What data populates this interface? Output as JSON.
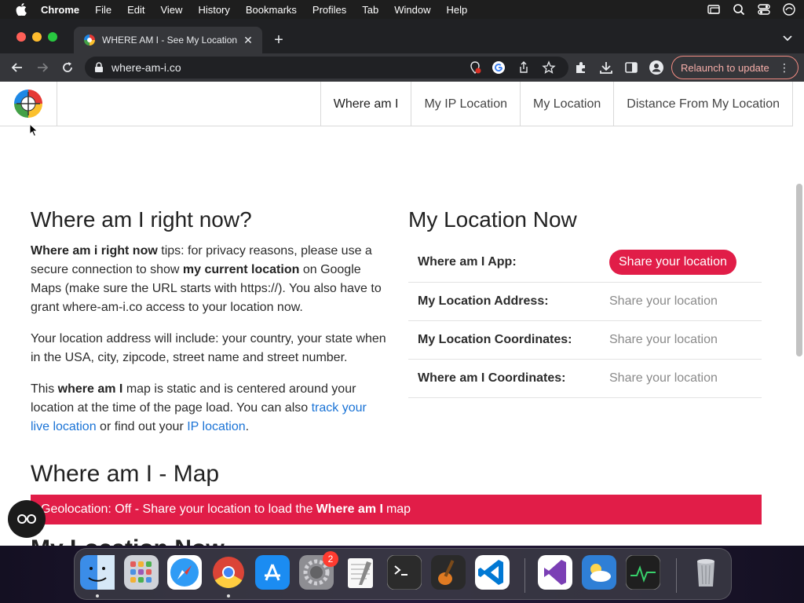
{
  "menubar": {
    "app_name": "Chrome",
    "items": [
      "File",
      "Edit",
      "View",
      "History",
      "Bookmarks",
      "Profiles",
      "Tab",
      "Window",
      "Help"
    ]
  },
  "browser": {
    "tab_title": "WHERE AM I - See My Location",
    "url": "where-am-i.co",
    "relaunch_label": "Relaunch to update"
  },
  "site": {
    "nav": [
      "Where am I",
      "My IP Location",
      "My Location",
      "Distance From My Location"
    ]
  },
  "intro": {
    "heading": "Where am I right now?",
    "p1_b1": "Where am i right now",
    "p1_t1": " tips: for privacy reasons, please use a secure connection to show ",
    "p1_b2": "my current location",
    "p1_t2": " on Google Maps (make sure the URL starts with https://). You also have to grant where-am-i.co access to your location now.",
    "p2": "Your location address will include: your country, your state when in the USA, city, zipcode, street name and street number.",
    "p3_t1": "This ",
    "p3_b1": "where am I",
    "p3_t2": " map is static and is centered around your location at the time of the page load. You can also ",
    "p3_link1": "track your live location",
    "p3_t3": " or find out your ",
    "p3_link2": "IP location",
    "p3_t4": "."
  },
  "location_now": {
    "heading": "My Location Now",
    "rows": [
      {
        "label": "Where am I App:",
        "value": "Share your location"
      },
      {
        "label": "My Location Address:",
        "value": "Share your location"
      },
      {
        "label": "My Location Coordinates:",
        "value": "Share your location"
      },
      {
        "label": "Where am I Coordinates:",
        "value": "Share your location"
      }
    ]
  },
  "map": {
    "heading": "Where am I - Map",
    "alert_pre": "Geolocation: Off - Share your location to load the",
    "alert_bold": "Where am I",
    "alert_post": "map",
    "next_heading": "My Location Now"
  },
  "dock": {
    "settings_badge": "2"
  },
  "colors": {
    "accent": "#e11d48",
    "link": "#1a73d6",
    "relaunch": "#f28b82"
  }
}
